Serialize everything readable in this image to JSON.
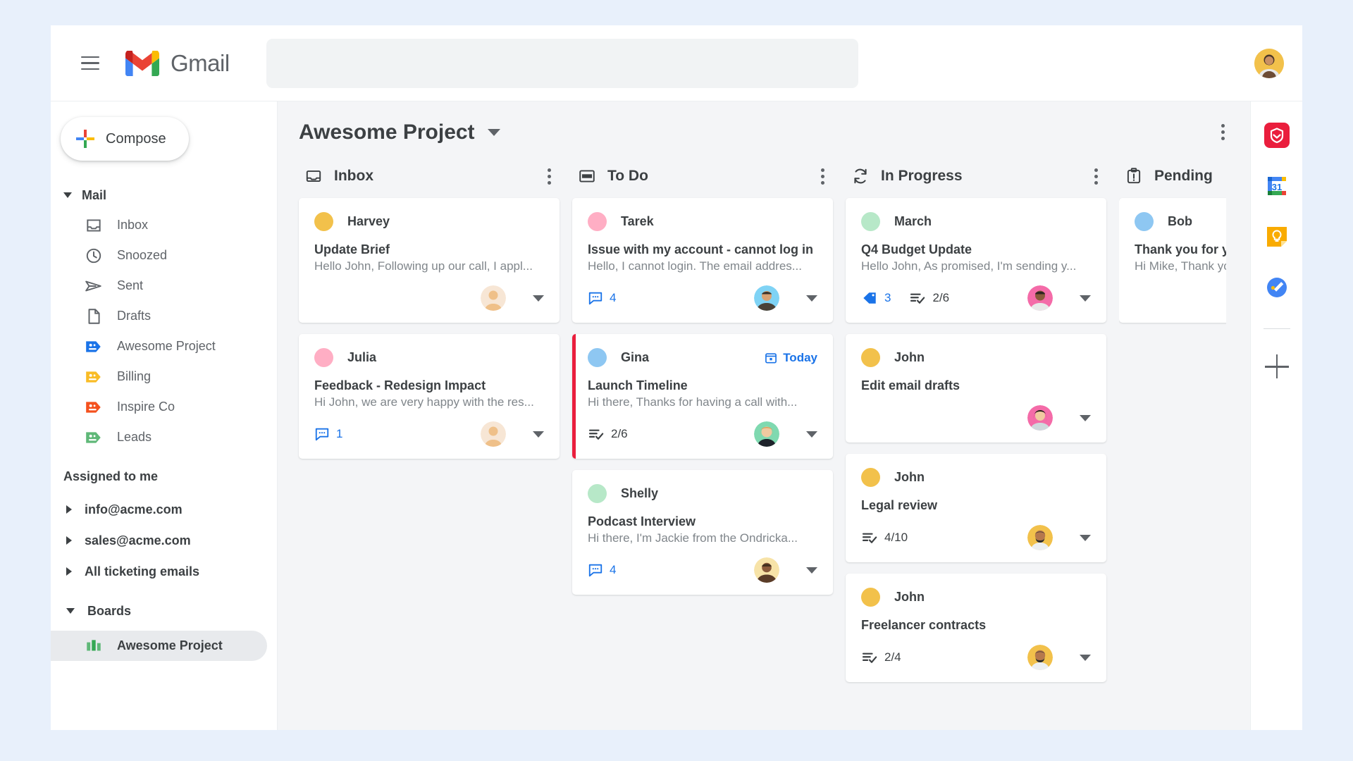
{
  "topbar": {
    "menu_icon": "hamburger-icon",
    "brand": "Gmail",
    "brand_logo_icon": "gmail-m-icon",
    "search": {
      "value": "",
      "placeholder": ""
    },
    "account_avatar_icon": "account-avatar"
  },
  "sidebar": {
    "compose": {
      "label": "Compose",
      "icon": "plus-color-icon"
    },
    "mail_group": {
      "label": "Mail",
      "expanded": true
    },
    "mail_items": [
      {
        "label": "Inbox",
        "icon": "inbox-icon",
        "color": "#5f6368"
      },
      {
        "label": "Snoozed",
        "icon": "clock-icon",
        "color": "#5f6368"
      },
      {
        "label": "Sent",
        "icon": "send-icon",
        "color": "#5f6368"
      },
      {
        "label": "Drafts",
        "icon": "document-icon",
        "color": "#5f6368"
      },
      {
        "label": "Awesome Project",
        "icon": "pipeline-tag-icon",
        "color": "#1a73e8"
      },
      {
        "label": "Billing",
        "icon": "pipeline-tag-icon",
        "color": "#f9bc26"
      },
      {
        "label": "Inspire Co",
        "icon": "pipeline-tag-icon",
        "color": "#f4511e"
      },
      {
        "label": "Leads",
        "icon": "pipeline-tag-icon",
        "color": "#5fb878"
      }
    ],
    "assigned_label": "Assigned to me",
    "assigned_items": [
      {
        "label": "info@acme.com",
        "expanded": false
      },
      {
        "label": "sales@acme.com",
        "expanded": false
      },
      {
        "label": "All ticketing emails",
        "expanded": false
      }
    ],
    "boards_group": {
      "label": "Boards",
      "expanded": true
    },
    "boards_items": [
      {
        "label": "Awesome Project",
        "icon": "board-bars-icon",
        "active": true
      }
    ]
  },
  "board": {
    "title": "Awesome Project",
    "title_caret_icon": "chevron-down-icon",
    "overflow_icon": "kebab-menu-icon",
    "columns": [
      {
        "name": "Inbox",
        "icon": "inbox-tray-icon",
        "clipped": false,
        "cards": [
          {
            "sender": "Harvey",
            "dot_color": "#f2c14b",
            "subject": "Update Brief",
            "snippet": "Hello John, Following up our call, I appl...",
            "flagged": false,
            "date_badge": "",
            "comments": "",
            "labels": "",
            "checklist": "",
            "assignee_avatar": "avatar-placeholder-beige"
          },
          {
            "sender": "Julia",
            "dot_color": "#ffaec4",
            "subject": "Feedback - Redesign Impact",
            "snippet": "Hi John, we are very happy with the res...",
            "flagged": false,
            "date_badge": "",
            "comments": "1",
            "labels": "",
            "checklist": "",
            "assignee_avatar": "avatar-placeholder-beige"
          }
        ]
      },
      {
        "name": "To Do",
        "icon": "todo-board-icon",
        "clipped": false,
        "cards": [
          {
            "sender": "Tarek",
            "dot_color": "#ffaec4",
            "subject": "Issue with my account - cannot log in",
            "snippet": "Hello, I cannot login. The email addres...",
            "flagged": false,
            "date_badge": "",
            "comments": "4",
            "labels": "",
            "checklist": "",
            "assignee_avatar": "avatar-man-blue"
          },
          {
            "sender": "Gina",
            "dot_color": "#8ec7f2",
            "subject": "Launch Timeline",
            "snippet": "Hi there, Thanks for having a call with...",
            "flagged": true,
            "date_badge": "Today",
            "comments": "",
            "labels": "",
            "checklist": "2/6",
            "assignee_avatar": "avatar-woman-green"
          },
          {
            "sender": "Shelly",
            "dot_color": "#b7e8c8",
            "subject": "Podcast Interview",
            "snippet": "Hi there, I'm Jackie from the Ondricka...",
            "flagged": false,
            "date_badge": "",
            "comments": "4",
            "labels": "",
            "checklist": "",
            "assignee_avatar": "avatar-man-brown"
          }
        ]
      },
      {
        "name": "In Progress",
        "icon": "sync-arrows-icon",
        "clipped": false,
        "cards": [
          {
            "sender": "March",
            "dot_color": "#b7e8c8",
            "subject": "Q4 Budget Update",
            "snippet": "Hello John, As promised, I'm sending y...",
            "flagged": false,
            "date_badge": "",
            "comments": "",
            "labels": "3",
            "checklist": "2/6",
            "assignee_avatar": "avatar-man-pink"
          },
          {
            "sender": "John",
            "dot_color": "#f2c14b",
            "subject": "Edit email drafts",
            "snippet": "",
            "flagged": false,
            "date_badge": "",
            "comments": "",
            "labels": "",
            "checklist": "",
            "assignee_avatar": "avatar-woman-pink"
          },
          {
            "sender": "John",
            "dot_color": "#f2c14b",
            "subject": "Legal review",
            "snippet": "",
            "flagged": false,
            "date_badge": "",
            "comments": "",
            "labels": "",
            "checklist": "4/10",
            "assignee_avatar": "avatar-man-beard"
          },
          {
            "sender": "John",
            "dot_color": "#f2c14b",
            "subject": "Freelancer contracts",
            "snippet": "",
            "flagged": false,
            "date_badge": "",
            "comments": "",
            "labels": "",
            "checklist": "2/4",
            "assignee_avatar": "avatar-man-beard"
          }
        ]
      },
      {
        "name": "Pending",
        "icon": "clipboard-alert-icon",
        "clipped": true,
        "cards": [
          {
            "sender": "Bob",
            "dot_color": "#8ec7f2",
            "subject": "Thank you for your help",
            "snippet": "Hi Mike, Thank you",
            "flagged": false,
            "date_badge": "",
            "comments": "",
            "labels": "",
            "checklist": "",
            "assignee_avatar": ""
          }
        ]
      }
    ]
  },
  "rail": {
    "items": [
      {
        "name": "drag-app-icon",
        "color": "#ea1e3d"
      },
      {
        "name": "google-calendar-icon",
        "color": "#1a73e8",
        "day": "31"
      },
      {
        "name": "google-keep-icon",
        "color": "#f9ab00"
      },
      {
        "name": "google-tasks-icon",
        "color": "#4285f4"
      }
    ],
    "add_label": "+",
    "add_icon": "plus-icon"
  },
  "colors": {
    "accent_blue": "#1a73e8",
    "flag_red": "#ea1e3d",
    "board_bg": "#f4f5f7",
    "page_bg": "#e8f0fb"
  }
}
